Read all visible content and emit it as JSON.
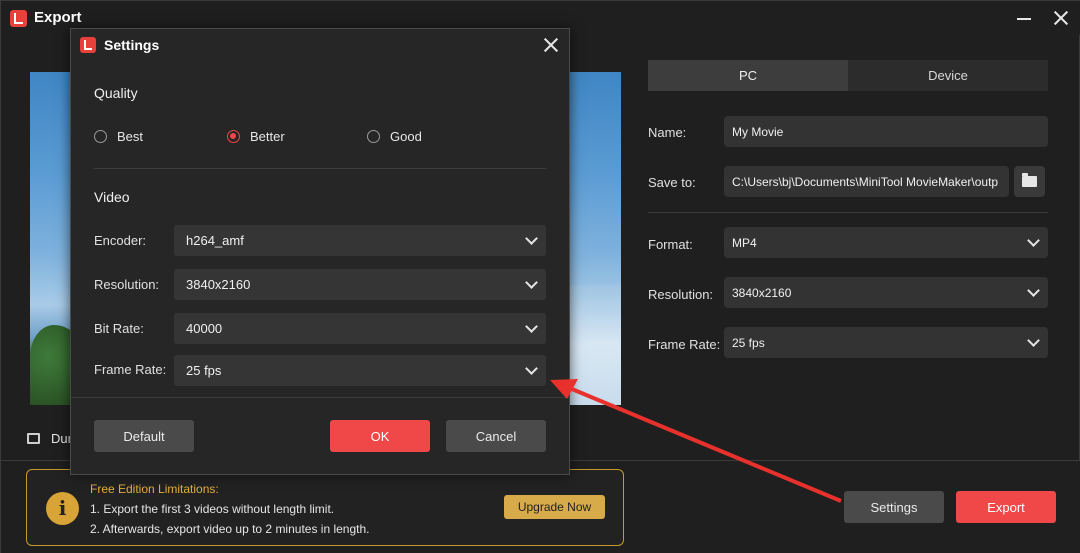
{
  "window": {
    "title": "Export"
  },
  "preview": {
    "duration_label": "Dur"
  },
  "output": {
    "tabs": [
      {
        "label": "PC",
        "active": true
      },
      {
        "label": "Device",
        "active": false
      }
    ],
    "name_label": "Name:",
    "name_value": "My Movie",
    "save_to_label": "Save to:",
    "save_to_value": "C:\\Users\\bj\\Documents\\MiniTool MovieMaker\\outp",
    "format_label": "Format:",
    "format_value": "MP4",
    "resolution_label": "Resolution:",
    "resolution_value": "3840x2160",
    "frame_rate_label": "Frame Rate:",
    "frame_rate_value": "25 fps"
  },
  "limitations": {
    "title": "Free Edition Limitations:",
    "line1": "1. Export the first 3 videos without length limit.",
    "line2": "2. Afterwards, export video up to 2 minutes in length.",
    "upgrade_label": "Upgrade Now"
  },
  "footer": {
    "settings_label": "Settings",
    "export_label": "Export"
  },
  "settings_dialog": {
    "title": "Settings",
    "quality_title": "Quality",
    "quality_options": [
      {
        "label": "Best",
        "checked": false
      },
      {
        "label": "Better",
        "checked": true
      },
      {
        "label": "Good",
        "checked": false
      }
    ],
    "video_title": "Video",
    "encoder_label": "Encoder:",
    "encoder_value": "h264_amf",
    "resolution_label": "Resolution:",
    "resolution_value": "3840x2160",
    "bit_rate_label": "Bit Rate:",
    "bit_rate_value": "40000",
    "frame_rate_label": "Frame Rate:",
    "frame_rate_value": "25 fps",
    "default_label": "Default",
    "ok_label": "OK",
    "cancel_label": "Cancel"
  },
  "colors": {
    "accent_red": "#f04848",
    "warning_gold": "#d7aa4a",
    "annotation_arrow": "#e8312c"
  }
}
